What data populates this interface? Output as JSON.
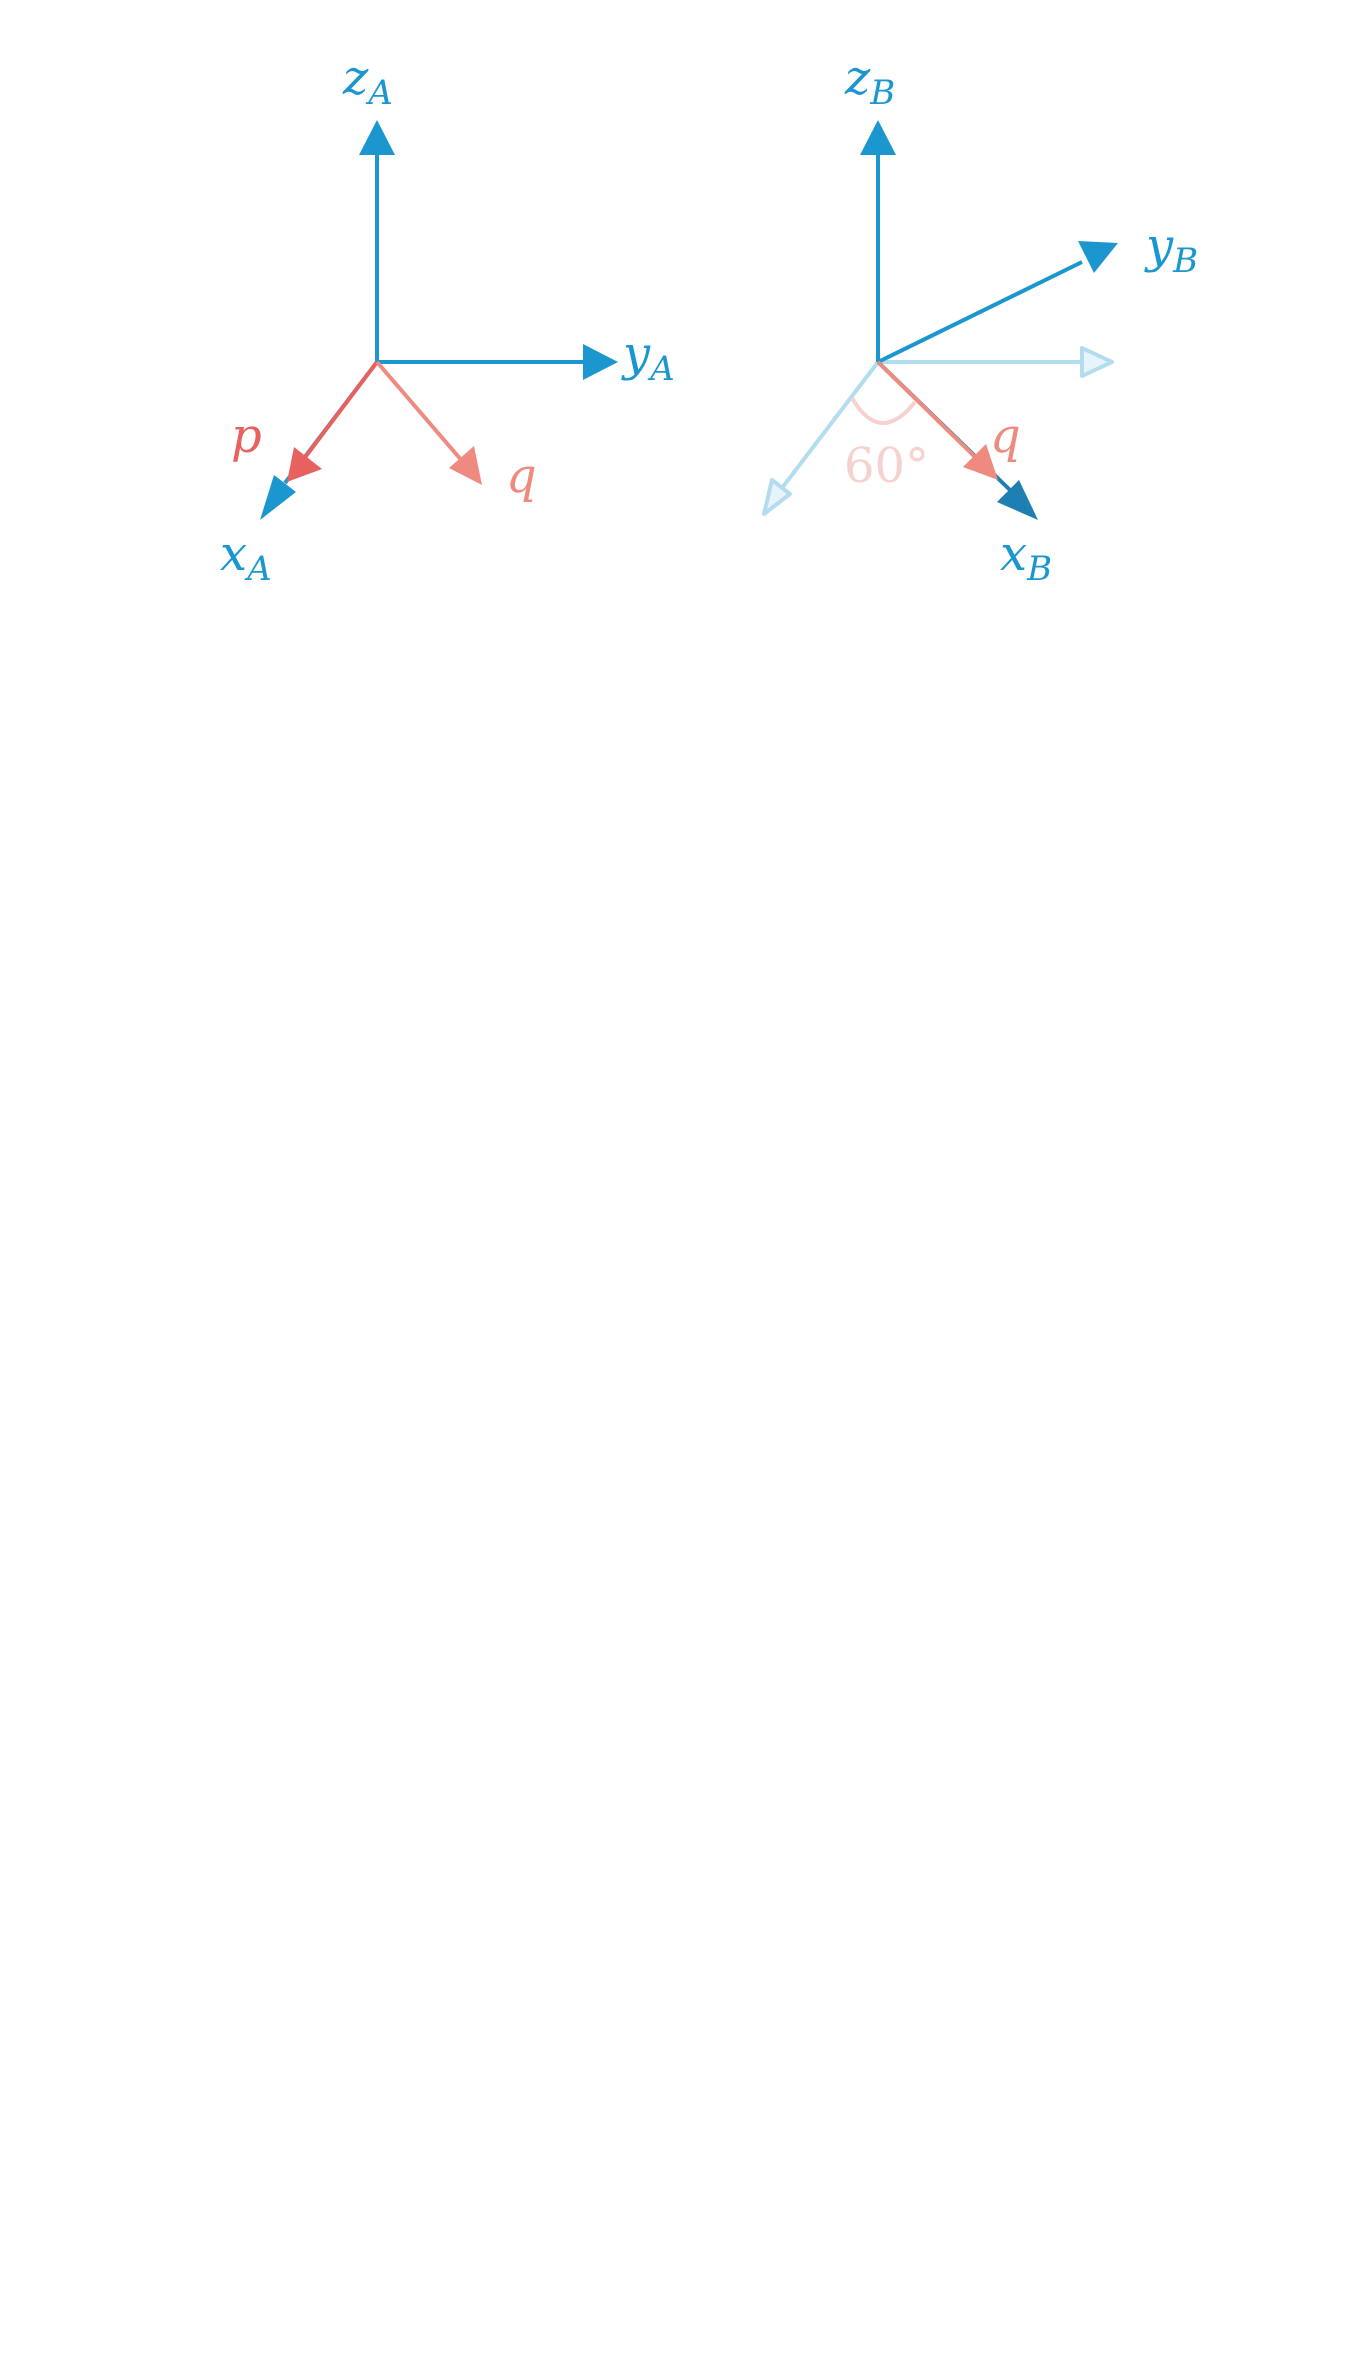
{
  "colors": {
    "axis": "#1b96cf",
    "axis_faded": "#b3dcef",
    "axis_dark": "#1f7fb2",
    "vec_p": "#e7615e",
    "vec_q": "#ef8a80",
    "angle_faded": "#f6d2cf"
  },
  "frame_a": {
    "z": {
      "base": "z",
      "sub": "A"
    },
    "y": {
      "base": "y",
      "sub": "A"
    },
    "x": {
      "base": "x",
      "sub": "A"
    },
    "p": "p",
    "q": "q"
  },
  "frame_b": {
    "z": {
      "base": "z",
      "sub": "B"
    },
    "y": {
      "base": "y",
      "sub": "B"
    },
    "x": {
      "base": "x",
      "sub": "B"
    },
    "q": "q",
    "angle": "60°"
  }
}
